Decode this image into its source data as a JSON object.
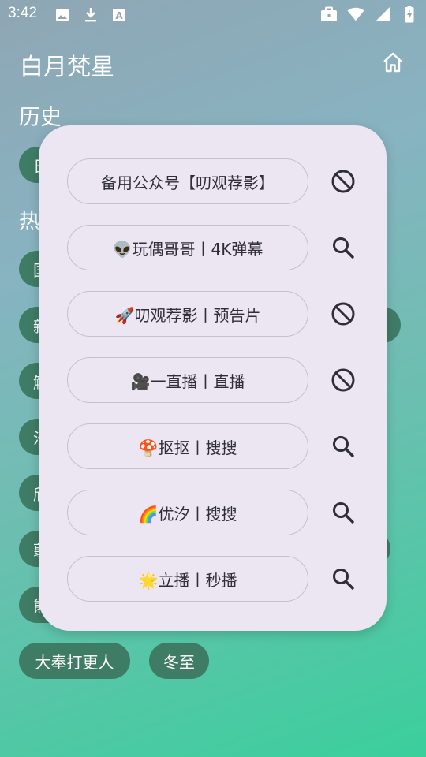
{
  "status_bar": {
    "time": "3:42",
    "icons_left": [
      "image-icon",
      "download-icon",
      "font-a-icon"
    ],
    "icons_right": [
      "briefcase-icon",
      "wifi-icon",
      "signal-icon",
      "battery-charging-icon"
    ]
  },
  "app": {
    "title": "白月梵星",
    "home_icon": "home-icon"
  },
  "sections": {
    "history_title": "历史",
    "hot_title": "热"
  },
  "background_chips": [
    {
      "label": "日"
    },
    {
      "label": "国"
    },
    {
      "label": "新"
    },
    {
      "label": "斛"
    },
    {
      "label": "汐"
    },
    {
      "label": "颀"
    },
    {
      "label": "翦"
    },
    {
      "label": "熊"
    },
    {
      "label": "大奉打更人"
    },
    {
      "label": "冬至"
    }
  ],
  "dialog": {
    "sources": [
      {
        "label": "备用公众号【叨观荐影】",
        "icon": "block-icon"
      },
      {
        "label": "👽玩偶哥哥丨4K弹幕",
        "icon": "search-icon"
      },
      {
        "label": "🚀叨观荐影丨预告片",
        "icon": "block-icon"
      },
      {
        "label": "🎥一直播丨直播",
        "icon": "block-icon"
      },
      {
        "label": "🍄抠抠丨搜搜",
        "icon": "search-icon"
      },
      {
        "label": "🌈优汐丨搜搜",
        "icon": "search-icon"
      },
      {
        "label": "🌟立播丨秒播",
        "icon": "search-icon"
      }
    ]
  },
  "colors": {
    "chip_bg": "#3f7c66",
    "dialog_bg": "#ebe6f2",
    "icon_dark": "#2f2d36"
  }
}
